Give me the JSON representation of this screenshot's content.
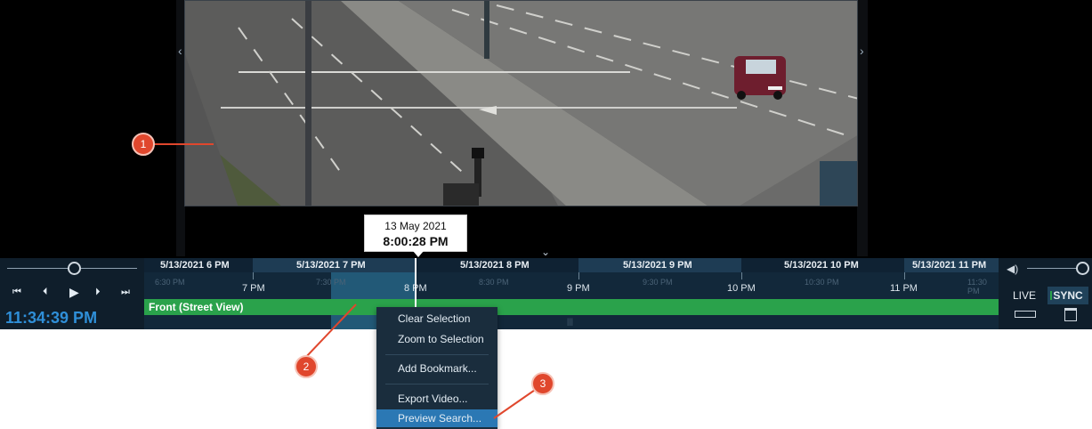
{
  "tooltip": {
    "date": "13 May 2021",
    "time": "8:00:28 PM"
  },
  "playback": {
    "clock": "11:34:39 PM",
    "buttons": {
      "first": "⏮",
      "prev": "⏴",
      "play": "▶",
      "next": "⏵",
      "last": "⏭"
    }
  },
  "timeline": {
    "date_labels": [
      "5/13/2021 6 PM",
      "5/13/2021 7 PM",
      "5/13/2021 8 PM",
      "5/13/2021 9 PM",
      "5/13/2021 10 PM",
      "5/13/2021 11 PM"
    ],
    "major_ticks": [
      "7 PM",
      "8 PM",
      "9 PM",
      "10 PM",
      "11 PM"
    ],
    "minor_ticks": [
      "6:30 PM",
      "7:30 PM",
      "8:30 PM",
      "9:30 PM",
      "10:30 PM",
      "11:30 PM"
    ],
    "track_label": "Front (Street View)",
    "grip": "|||"
  },
  "right_panel": {
    "live": "LIVE",
    "sync": "SYNC",
    "volume_icon": "◀)"
  },
  "context_menu": {
    "items": [
      "Clear Selection",
      "Zoom to Selection",
      "Add Bookmark...",
      "Export Video...",
      "Preview Search..."
    ],
    "active": "Preview Search..."
  },
  "callouts": [
    "1",
    "2",
    "3"
  ],
  "icons": {
    "left_arrow": "‹",
    "right_arrow": "›",
    "collapse": "⌄"
  },
  "colors": {
    "accent": "#2f8fd8",
    "track": "#2aa24b",
    "callout": "#e0472d",
    "menu_active": "#2b78b4"
  }
}
